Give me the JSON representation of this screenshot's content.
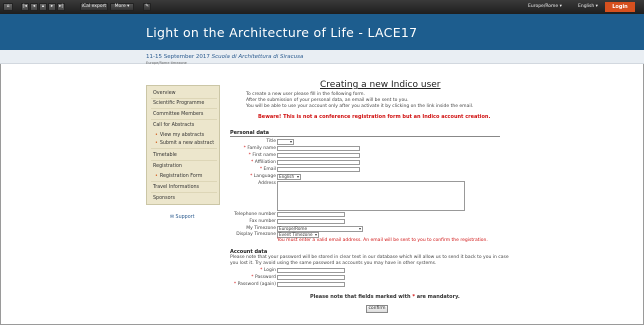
{
  "toolbar": {
    "home_icon": "home-icon",
    "nav_icons": [
      "first-icon",
      "prev-icon",
      "up-icon",
      "next-icon",
      "last-icon"
    ],
    "ical_label": "iCal export",
    "more_label": "More ▾",
    "timezone": "Europe/Rome ▾",
    "language": "English ▾",
    "login_label": "Login"
  },
  "header": {
    "title": "Light on the Architecture of Life - LACE17",
    "dates": "11-15 September 2017",
    "venue": "Scuola di Architettura di Siracusa",
    "timezone_note": "Europe/Rome timezone"
  },
  "sidebar": {
    "items": [
      {
        "label": "Overview"
      },
      {
        "label": "Scientific Programme"
      },
      {
        "label": "Committee Members"
      },
      {
        "label": "Call for Abstracts"
      },
      {
        "label": "View my abstracts"
      },
      {
        "label": "Submit a new abstract"
      },
      {
        "label": "Timetable"
      },
      {
        "label": "Registration"
      },
      {
        "label": "Registration Form"
      },
      {
        "label": "Travel Informations"
      },
      {
        "label": "Sponsors"
      }
    ],
    "support": "Support"
  },
  "main": {
    "title": "Creating a new Indico user",
    "intro": [
      "To create a new user please fill in the following form.",
      "After the submission of your personal data, an email will be sent to you.",
      "You will be able to use your account only after you activate it by clicking on the link inside the email."
    ],
    "warning": "Beware! This is not a conference registration form but an Indico account creation.",
    "personal_title": "Personal data",
    "fields": {
      "title": "Title",
      "family_name": "Family name",
      "first_name": "First name",
      "affiliation": "Affiliation",
      "email": "Email",
      "language": "Language",
      "address": "Address",
      "telephone": "Telephone number",
      "fax": "Fax number",
      "my_timezone": "My Timezone",
      "display_timezone": "Display Timezone"
    },
    "values": {
      "title": "",
      "language": "English",
      "my_timezone": "Europe/Rome",
      "display_timezone": "Event Timezone"
    },
    "email_error": "You must enter a valid email address. An email will be sent to you to confirm the registration.",
    "account_title": "Account data",
    "account_text": [
      "Please note that your password will be stored in clear text in our database which will allow us to send it back to you in case",
      "you lost it. Try avoid using the same password as accounts you may have in other systems."
    ],
    "account_fields": {
      "login": "Login",
      "password": "Password",
      "password_again": "Password (again)"
    },
    "mandatory_prefix": "Please note that fields marked with",
    "mandatory_suffix": "are mandatory.",
    "confirm_label": "confirm"
  },
  "colors": {
    "banner": "#1d5d8e",
    "login": "#d6501e",
    "warning": "#d01010",
    "sidebar": "#ece6cc"
  }
}
